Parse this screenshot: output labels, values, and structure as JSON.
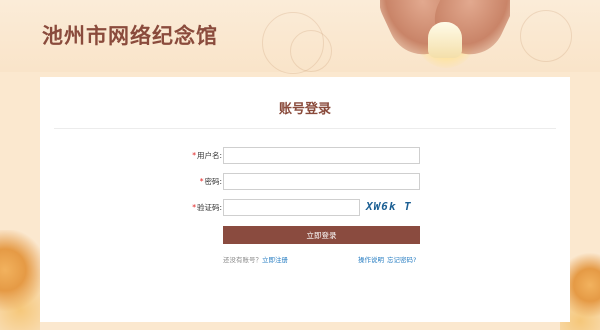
{
  "header": {
    "site_title": "池州市网络纪念馆"
  },
  "login": {
    "title": "账号登录",
    "username_label": "用户名:",
    "username_value": "",
    "password_label": "密码:",
    "password_value": "",
    "captcha_label": "验证码:",
    "captcha_value": "",
    "captcha_image_text": "XW6k T",
    "submit_label": "立即登录",
    "no_account_text": "还没有账号？",
    "register_link": "立即注册",
    "help_link": "操作说明",
    "forgot_link": "忘记密码?"
  },
  "colors": {
    "brand": "#8a4b3c",
    "button": "#8a4b3f",
    "link": "#2a7fc3",
    "required": "#e02020",
    "page_background": "#fbe8cf"
  }
}
